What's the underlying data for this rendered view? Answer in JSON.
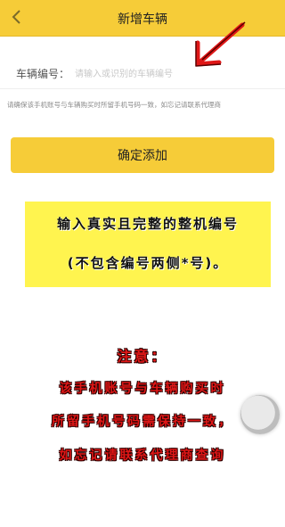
{
  "header": {
    "title": "新增车辆",
    "back_icon": "chevron-left-icon",
    "background": "#f6cc38"
  },
  "form": {
    "plate_label": "车辆编号：",
    "plate_placeholder": "请输入或识别的车辆编号",
    "hint": "请确保该手机账号与车辆购买时所留手机号码一致，如忘记请联系代理商"
  },
  "confirm_button": {
    "label": "确定添加"
  },
  "annotation": {
    "line1": "输入真实且完整的整机编号",
    "line2": "(不包含编号两侧*号)。"
  },
  "notice": {
    "title": "注意：",
    "line1": "该手机账号与车辆购买时",
    "line2": "所留手机号码需保持一致，",
    "line3": "如忘记请联系代理商查询"
  },
  "colors": {
    "accent": "#f6cc38",
    "highlight": "#fff44f",
    "arrow": "#e01717",
    "notice_text": "#e01717"
  }
}
